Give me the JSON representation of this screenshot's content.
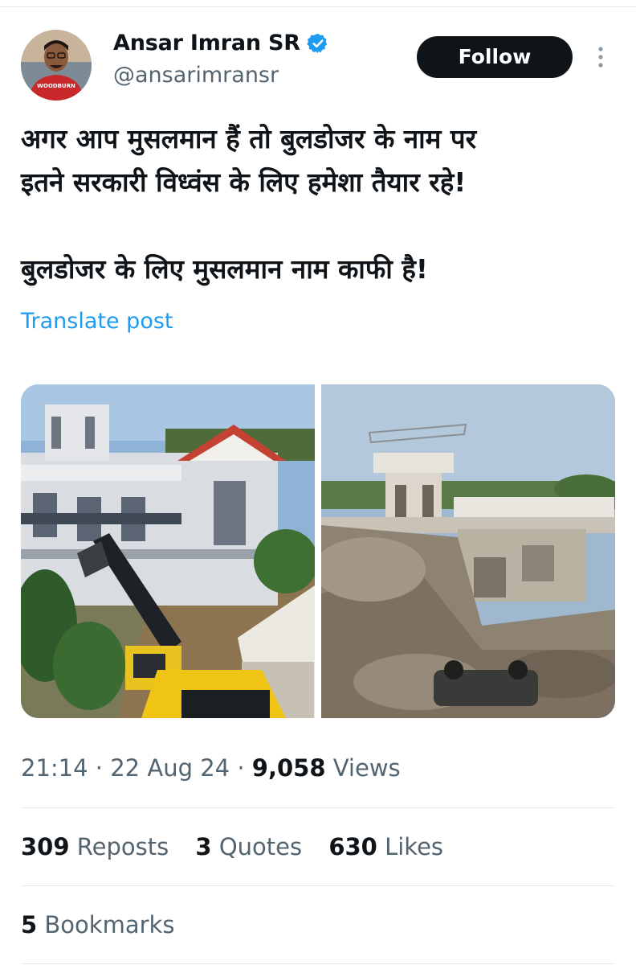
{
  "author": {
    "display_name": "Ansar Imran SR",
    "handle": "@ansarimransr",
    "avatar_shirt_text": "WOODBURN"
  },
  "follow_label": "Follow",
  "post": {
    "line1": "अगर आप मुसलमान हैं तो बुलडोजर के नाम पर",
    "line2": "इतने सरकारी विध्वंस के लिए हमेशा तैयार रहे!",
    "line3": "बुलडोजर के लिए मुसलमान नाम काफी है!"
  },
  "translate_label": "Translate post",
  "meta": {
    "time": "21:14",
    "separator": " · ",
    "date": "22 Aug 24",
    "views_count": "9,058",
    "views_label": "Views"
  },
  "stats": {
    "reposts_count": "309",
    "reposts_label": "Reposts",
    "quotes_count": "3",
    "quotes_label": "Quotes",
    "likes_count": "630",
    "likes_label": "Likes",
    "bookmarks_count": "5",
    "bookmarks_label": "Bookmarks"
  },
  "colors": {
    "link": "#1d9bf0",
    "verified": "#1d9bf0",
    "button_bg": "#0f1419",
    "secondary_text": "#536471"
  },
  "icons": [
    "verified-badge-icon",
    "more-options-icon"
  ]
}
